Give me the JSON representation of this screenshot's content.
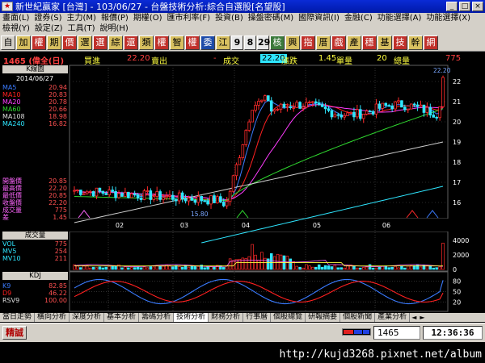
{
  "window": {
    "title": "新世紀贏家 [台灣] - 103/06/27 - 台盤技術分析:綜合自選股[名望股]",
    "app_icon": "app-icon",
    "controls": [
      "_",
      "□",
      "×"
    ]
  },
  "menu": {
    "row1": [
      "畫面(L)",
      "證券(S)",
      "主力(M)",
      "報價(P)",
      "期權(O)",
      "匯市利率(F)",
      "投資(B)",
      "操盤密碼(M)",
      "國際資訊(I)",
      "金融(C)",
      "功能選擇(A)",
      "功能選擇(X)"
    ],
    "row2": [
      "檢視(Y)",
      "設定(Z)",
      "工具(T)",
      "說明(H)"
    ]
  },
  "toolbar": {
    "buttons": [
      {
        "label": "自",
        "style": "grey"
      },
      {
        "label": "加",
        "style": "gold"
      },
      {
        "label": "權",
        "style": "red"
      },
      {
        "label": "期",
        "style": "gold"
      },
      {
        "label": "價",
        "style": "red"
      },
      {
        "label": "選",
        "style": "gold"
      },
      {
        "label": "選",
        "style": "red"
      },
      {
        "label": "綜",
        "style": "gold"
      },
      {
        "label": "還",
        "style": "red"
      },
      {
        "label": "類",
        "style": "gold"
      },
      {
        "label": "權",
        "style": "red"
      },
      {
        "label": "智",
        "style": "gold"
      },
      {
        "label": "權",
        "style": "red"
      },
      {
        "label": "委",
        "style": "blue"
      },
      {
        "label": "江",
        "style": "gold"
      },
      {
        "label": "9",
        "style": "num"
      },
      {
        "label": "8",
        "style": "num"
      },
      {
        "label": "29",
        "style": "num"
      },
      {
        "label": "核",
        "style": "green"
      },
      {
        "label": "興",
        "style": "gold"
      },
      {
        "label": "指",
        "style": "red"
      },
      {
        "label": "厝",
        "style": "gold"
      },
      {
        "label": "戲",
        "style": "red"
      },
      {
        "label": "產",
        "style": "gold"
      },
      {
        "label": "穩",
        "style": "red"
      },
      {
        "label": "基",
        "style": "gold"
      },
      {
        "label": "技",
        "style": "red"
      },
      {
        "label": "幹",
        "style": "gold"
      },
      {
        "label": "網",
        "style": "red"
      }
    ]
  },
  "quote": {
    "code_name": "1465 (偉全(日)",
    "buy_label": "買進",
    "buy_value": "22.20",
    "sell_label": "賣出",
    "sell_value": "-",
    "deal_label": "成交",
    "deal_value": "22.20",
    "change_label": "漲跌",
    "change_value": "1.45",
    "vol_label": "單量",
    "vol_value": "20",
    "total_label": "總量",
    "total_value": "775"
  },
  "kline": {
    "box_label": "K線圖",
    "date": "2014/06/27",
    "ma": [
      {
        "name": "MA5",
        "value": "20.94",
        "color": "#3a7bff"
      },
      {
        "name": "MA10",
        "value": "20.83",
        "color": "#ff2020"
      },
      {
        "name": "MA20",
        "value": "20.78",
        "color": "#ff3cff"
      },
      {
        "name": "MA60",
        "value": "20.66",
        "color": "#2fd82f"
      },
      {
        "name": "MA108",
        "value": "18.98",
        "color": "#dddddd"
      },
      {
        "name": "MA240",
        "value": "16.82",
        "color": "#2ee6ff"
      }
    ],
    "ohlc": [
      {
        "name": "開盤價",
        "value": "20.85"
      },
      {
        "name": "最高價",
        "value": "22.20"
      },
      {
        "name": "最低價",
        "value": "20.85"
      },
      {
        "name": "收盤價",
        "value": "22.20"
      },
      {
        "name": "成交量",
        "value": "775"
      },
      {
        "name": "差",
        "value": "1.45"
      }
    ],
    "right_ticks": [
      "22",
      "21",
      "20",
      "19",
      "18",
      "17",
      "16"
    ],
    "top_price_label": "22.20",
    "low_price_label": "15.80",
    "months": [
      "02",
      "03",
      "04",
      "05",
      "06"
    ]
  },
  "volume": {
    "box_label": "成交量",
    "items": [
      {
        "name": "VOL",
        "value": "775"
      },
      {
        "name": "MV5",
        "value": "254"
      },
      {
        "name": "MV10",
        "value": "211"
      }
    ],
    "right_ticks": [
      "4000",
      "2000",
      "0"
    ]
  },
  "kd": {
    "box_label": "KDJ",
    "items": [
      {
        "name": "K9",
        "value": "82.85",
        "color": "#3a7bff"
      },
      {
        "name": "D9",
        "value": "46.22",
        "color": "#ff2020"
      },
      {
        "name": "RSV9",
        "value": "100.00",
        "color": "#dddddd"
      }
    ],
    "right_ticks": [
      "80",
      "50",
      "20"
    ]
  },
  "tabs": [
    "當日走勢",
    "橫向分析",
    "深度分析",
    "基本分析",
    "籌碼分析",
    "技術分析",
    "財務分析",
    "行事曆",
    "個股總覽",
    "研報摘要",
    "個股新聞",
    "產業分析"
  ],
  "active_tab": "技術分析",
  "status": {
    "button_label": "精誠",
    "code": "1465",
    "clock": "12:36:36"
  },
  "watermark": "http://kujd3268.pixnet.net/album"
}
